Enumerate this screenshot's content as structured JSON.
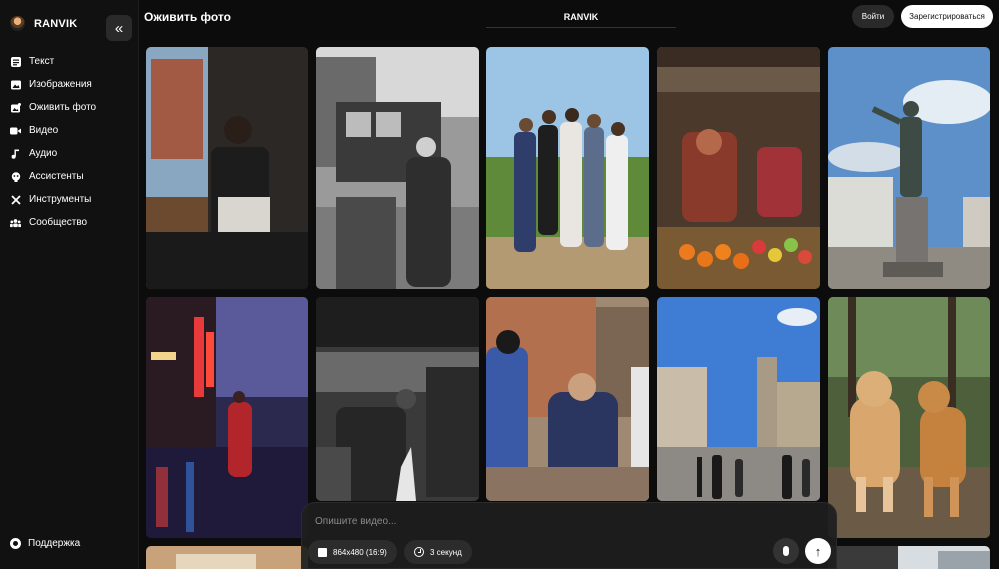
{
  "sidebar": {
    "brand": "RANVIK",
    "collapse_icon": "«",
    "items": [
      {
        "label": "Текст",
        "icon": "text-icon"
      },
      {
        "label": "Изображения",
        "icon": "image-icon"
      },
      {
        "label": "Оживить фото",
        "icon": "animate-photo-icon"
      },
      {
        "label": "Видео",
        "icon": "video-icon"
      },
      {
        "label": "Аудио",
        "icon": "music-icon"
      },
      {
        "label": "Ассистенты",
        "icon": "assistant-icon"
      },
      {
        "label": "Инструменты",
        "icon": "tools-icon"
      },
      {
        "label": "Сообщество",
        "icon": "community-icon"
      }
    ],
    "support": "Поддержка"
  },
  "header": {
    "title": "Оживить фото",
    "brand": "RANVIK",
    "login": "Войти",
    "signup": "Зарегистрироваться"
  },
  "prompt": {
    "placeholder": "Опишите видео...",
    "resolution": "864x480 (16:9)",
    "duration": "3 секунд",
    "send_icon": "↑"
  }
}
